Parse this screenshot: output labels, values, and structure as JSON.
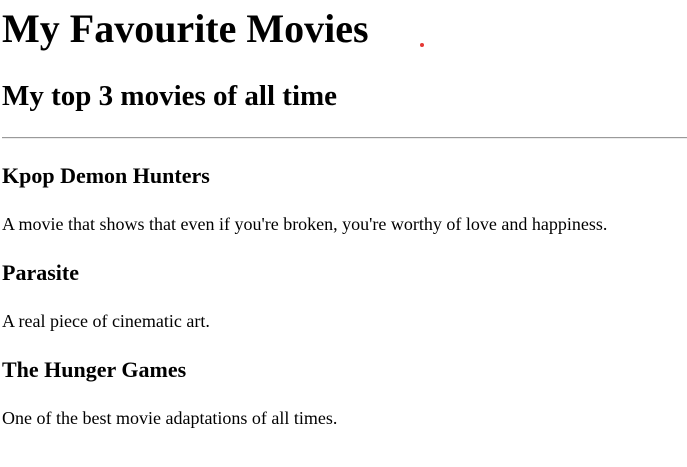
{
  "page": {
    "title": "My Favourite Movies",
    "subtitle": "My top 3 movies of all time"
  },
  "movies": [
    {
      "title": "Kpop Demon Hunters",
      "description": "A movie that shows that even if you're broken, you're worthy of love and happiness."
    },
    {
      "title": "Parasite",
      "description": "A real piece of cinematic art."
    },
    {
      "title": "The Hunger Games",
      "description": "One of the best movie adaptations of all times."
    }
  ],
  "colors": {
    "text": "#000000",
    "background": "#ffffff",
    "divider": "#9a9a9a",
    "cursor_dot": "#e53935"
  }
}
